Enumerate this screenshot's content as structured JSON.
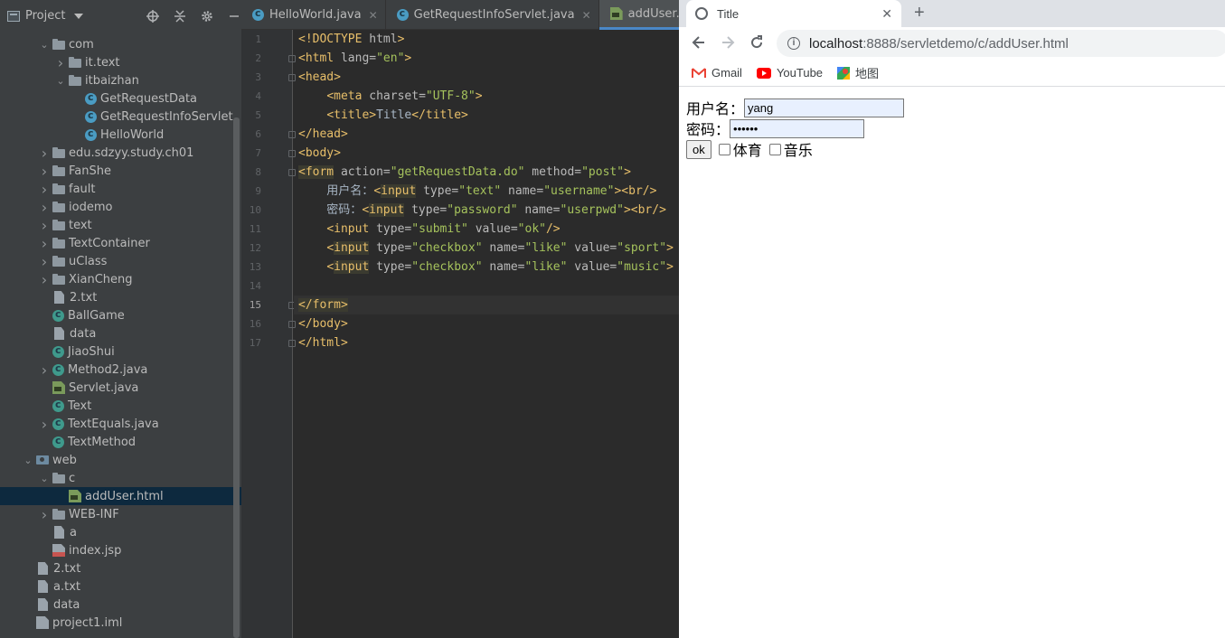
{
  "project_panel": {
    "title": "Project",
    "tree": [
      {
        "label": "com",
        "indent": 2,
        "chevron": "down",
        "icon": "folder"
      },
      {
        "label": "it.text",
        "indent": 3,
        "chevron": "right",
        "icon": "folder"
      },
      {
        "label": "itbaizhan",
        "indent": 3,
        "chevron": "down",
        "icon": "folder"
      },
      {
        "label": "GetRequestData",
        "indent": 4,
        "chevron": "",
        "icon": "java"
      },
      {
        "label": "GetRequestInfoServlet",
        "indent": 4,
        "chevron": "",
        "icon": "java"
      },
      {
        "label": "HelloWorld",
        "indent": 4,
        "chevron": "",
        "icon": "java"
      },
      {
        "label": "edu.sdzyy.study.ch01",
        "indent": 2,
        "chevron": "right",
        "icon": "folder"
      },
      {
        "label": "FanShe",
        "indent": 2,
        "chevron": "right",
        "icon": "folder"
      },
      {
        "label": "fault",
        "indent": 2,
        "chevron": "right",
        "icon": "folder"
      },
      {
        "label": "iodemo",
        "indent": 2,
        "chevron": "right",
        "icon": "folder"
      },
      {
        "label": "text",
        "indent": 2,
        "chevron": "right",
        "icon": "folder"
      },
      {
        "label": "TextContainer",
        "indent": 2,
        "chevron": "right",
        "icon": "folder"
      },
      {
        "label": "uClass",
        "indent": 2,
        "chevron": "right",
        "icon": "folder"
      },
      {
        "label": "XianCheng",
        "indent": 2,
        "chevron": "right",
        "icon": "folder"
      },
      {
        "label": "2.txt",
        "indent": 2,
        "chevron": "",
        "icon": "file"
      },
      {
        "label": "BallGame",
        "indent": 2,
        "chevron": "",
        "icon": "javaalt"
      },
      {
        "label": "data",
        "indent": 2,
        "chevron": "",
        "icon": "file"
      },
      {
        "label": "JiaoShui",
        "indent": 2,
        "chevron": "",
        "icon": "javaalt"
      },
      {
        "label": "Method2.java",
        "indent": 2,
        "chevron": "right",
        "icon": "javaalt"
      },
      {
        "label": "Servlet.java",
        "indent": 2,
        "chevron": "",
        "icon": "html"
      },
      {
        "label": "Text",
        "indent": 2,
        "chevron": "",
        "icon": "javaalt"
      },
      {
        "label": "TextEquals.java",
        "indent": 2,
        "chevron": "right",
        "icon": "javaalt"
      },
      {
        "label": "TextMethod",
        "indent": 2,
        "chevron": "",
        "icon": "javaalt"
      },
      {
        "label": "web",
        "indent": 1,
        "chevron": "down",
        "icon": "webfolder"
      },
      {
        "label": "c",
        "indent": 2,
        "chevron": "down",
        "icon": "folder"
      },
      {
        "label": "addUser.html",
        "indent": 3,
        "chevron": "",
        "icon": "html",
        "selected": true
      },
      {
        "label": "WEB-INF",
        "indent": 2,
        "chevron": "right",
        "icon": "folder"
      },
      {
        "label": "a",
        "indent": 2,
        "chevron": "",
        "icon": "file"
      },
      {
        "label": "index.jsp",
        "indent": 2,
        "chevron": "",
        "icon": "jsp"
      },
      {
        "label": "2.txt",
        "indent": 1,
        "chevron": "",
        "icon": "file"
      },
      {
        "label": "a.txt",
        "indent": 1,
        "chevron": "",
        "icon": "file"
      },
      {
        "label": "data",
        "indent": 1,
        "chevron": "",
        "icon": "file"
      },
      {
        "label": "project1.iml",
        "indent": 1,
        "chevron": "",
        "icon": "iml"
      }
    ]
  },
  "editor": {
    "tabs": [
      {
        "label": "HelloWorld.java",
        "icon": "java",
        "active": false
      },
      {
        "label": "GetRequestInfoServlet.java",
        "icon": "java",
        "active": false
      },
      {
        "label": "addUser.html",
        "icon": "html",
        "active": true
      }
    ],
    "current_line": 15,
    "lines": [
      [
        {
          "t": "<!DOCTYPE",
          "c": "k-doc"
        },
        {
          "t": " html",
          "c": "k-attr"
        },
        {
          "t": ">",
          "c": "k-doc"
        }
      ],
      [
        {
          "t": "<html",
          "c": "k-tag"
        },
        {
          "t": " lang=",
          "c": "k-attr"
        },
        {
          "t": "\"en\"",
          "c": "k-str"
        },
        {
          "t": ">",
          "c": "k-tag"
        }
      ],
      [
        {
          "t": "<head>",
          "c": "k-tag"
        }
      ],
      [
        {
          "t": "    ",
          "c": "k-txt"
        },
        {
          "t": "<meta",
          "c": "k-tag"
        },
        {
          "t": " charset=",
          "c": "k-attr"
        },
        {
          "t": "\"UTF-8\"",
          "c": "k-str"
        },
        {
          "t": ">",
          "c": "k-tag"
        }
      ],
      [
        {
          "t": "    ",
          "c": "k-txt"
        },
        {
          "t": "<title>",
          "c": "k-tag"
        },
        {
          "t": "Title",
          "c": "k-txt"
        },
        {
          "t": "</title>",
          "c": "k-tag"
        }
      ],
      [
        {
          "t": "</head>",
          "c": "k-tag"
        }
      ],
      [
        {
          "t": "<body>",
          "c": "k-tag"
        }
      ],
      [
        {
          "t": "<form",
          "c": "k-tag hl"
        },
        {
          "t": " action=",
          "c": "k-attr"
        },
        {
          "t": "\"getRequestData.do\"",
          "c": "k-str"
        },
        {
          "t": " method=",
          "c": "k-attr"
        },
        {
          "t": "\"post\"",
          "c": "k-str"
        },
        {
          "t": ">",
          "c": "k-tag"
        }
      ],
      [
        {
          "t": "    用户名：",
          "c": "k-txt"
        },
        {
          "t": "<",
          "c": "k-tag"
        },
        {
          "t": "input",
          "c": "k-tag hl"
        },
        {
          "t": " type=",
          "c": "k-attr"
        },
        {
          "t": "\"text\"",
          "c": "k-str"
        },
        {
          "t": " name=",
          "c": "k-attr"
        },
        {
          "t": "\"username\"",
          "c": "k-str"
        },
        {
          "t": "><br/>",
          "c": "k-tag"
        }
      ],
      [
        {
          "t": "    密码：",
          "c": "k-txt"
        },
        {
          "t": "<",
          "c": "k-tag"
        },
        {
          "t": "input",
          "c": "k-tag hl"
        },
        {
          "t": " type=",
          "c": "k-attr"
        },
        {
          "t": "\"password\"",
          "c": "k-str"
        },
        {
          "t": " name=",
          "c": "k-attr"
        },
        {
          "t": "\"userpwd\"",
          "c": "k-str"
        },
        {
          "t": "><br/>",
          "c": "k-tag"
        }
      ],
      [
        {
          "t": "    ",
          "c": "k-txt"
        },
        {
          "t": "<input",
          "c": "k-tag"
        },
        {
          "t": " type=",
          "c": "k-attr"
        },
        {
          "t": "\"submit\"",
          "c": "k-str"
        },
        {
          "t": " value=",
          "c": "k-attr"
        },
        {
          "t": "\"ok\"",
          "c": "k-str"
        },
        {
          "t": "/>",
          "c": "k-tag"
        }
      ],
      [
        {
          "t": "    ",
          "c": "k-txt"
        },
        {
          "t": "<",
          "c": "k-tag"
        },
        {
          "t": "input",
          "c": "k-tag hl"
        },
        {
          "t": " type=",
          "c": "k-attr"
        },
        {
          "t": "\"checkbox\"",
          "c": "k-str"
        },
        {
          "t": " name=",
          "c": "k-attr"
        },
        {
          "t": "\"like\"",
          "c": "k-str"
        },
        {
          "t": " value=",
          "c": "k-attr"
        },
        {
          "t": "\"sport\"",
          "c": "k-str"
        },
        {
          "t": ">",
          "c": "k-tag"
        }
      ],
      [
        {
          "t": "    ",
          "c": "k-txt"
        },
        {
          "t": "<",
          "c": "k-tag"
        },
        {
          "t": "input",
          "c": "k-tag hl"
        },
        {
          "t": " type=",
          "c": "k-attr"
        },
        {
          "t": "\"checkbox\"",
          "c": "k-str"
        },
        {
          "t": " name=",
          "c": "k-attr"
        },
        {
          "t": "\"like\"",
          "c": "k-str"
        },
        {
          "t": " value=",
          "c": "k-attr"
        },
        {
          "t": "\"music\"",
          "c": "k-str"
        },
        {
          "t": ">",
          "c": "k-tag"
        }
      ],
      [],
      [
        {
          "t": "</form>",
          "c": "k-tag hl"
        }
      ],
      [
        {
          "t": "</body>",
          "c": "k-tag"
        }
      ],
      [
        {
          "t": "</html>",
          "c": "k-tag"
        }
      ]
    ]
  },
  "browser": {
    "tab_title": "Title",
    "url_host": "localhost",
    "url_path": ":8888/servletdemo/c/addUser.html",
    "bookmarks": [
      "Gmail",
      "YouTube",
      "地图"
    ],
    "form": {
      "username_label": "用户名：",
      "username_value": "yang",
      "password_label": "密码：",
      "password_mask": "••••••",
      "submit_label": "ok",
      "checkbox_sport_label": "体育",
      "checkbox_music_label": "音乐"
    }
  }
}
